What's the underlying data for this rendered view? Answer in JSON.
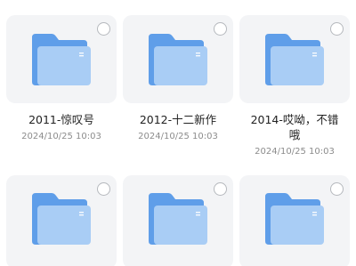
{
  "items": [
    {
      "name": "2011-惊叹号",
      "date": "2024/10/25 10:03",
      "icon": "folder-icon"
    },
    {
      "name": "2012-十二新作",
      "date": "2024/10/25 10:03",
      "icon": "folder-icon"
    },
    {
      "name": "2014-哎呦，不错哦",
      "date": "2024/10/25 10:03",
      "icon": "folder-icon"
    },
    {
      "name": "",
      "date": "",
      "icon": "folder-icon"
    },
    {
      "name": "",
      "date": "",
      "icon": "folder-icon"
    },
    {
      "name": "",
      "date": "",
      "icon": "folder-icon"
    }
  ],
  "colors": {
    "tile_bg": "#f3f4f6",
    "folder_back": "#5f9ee9",
    "folder_front": "#a9cdf5"
  }
}
